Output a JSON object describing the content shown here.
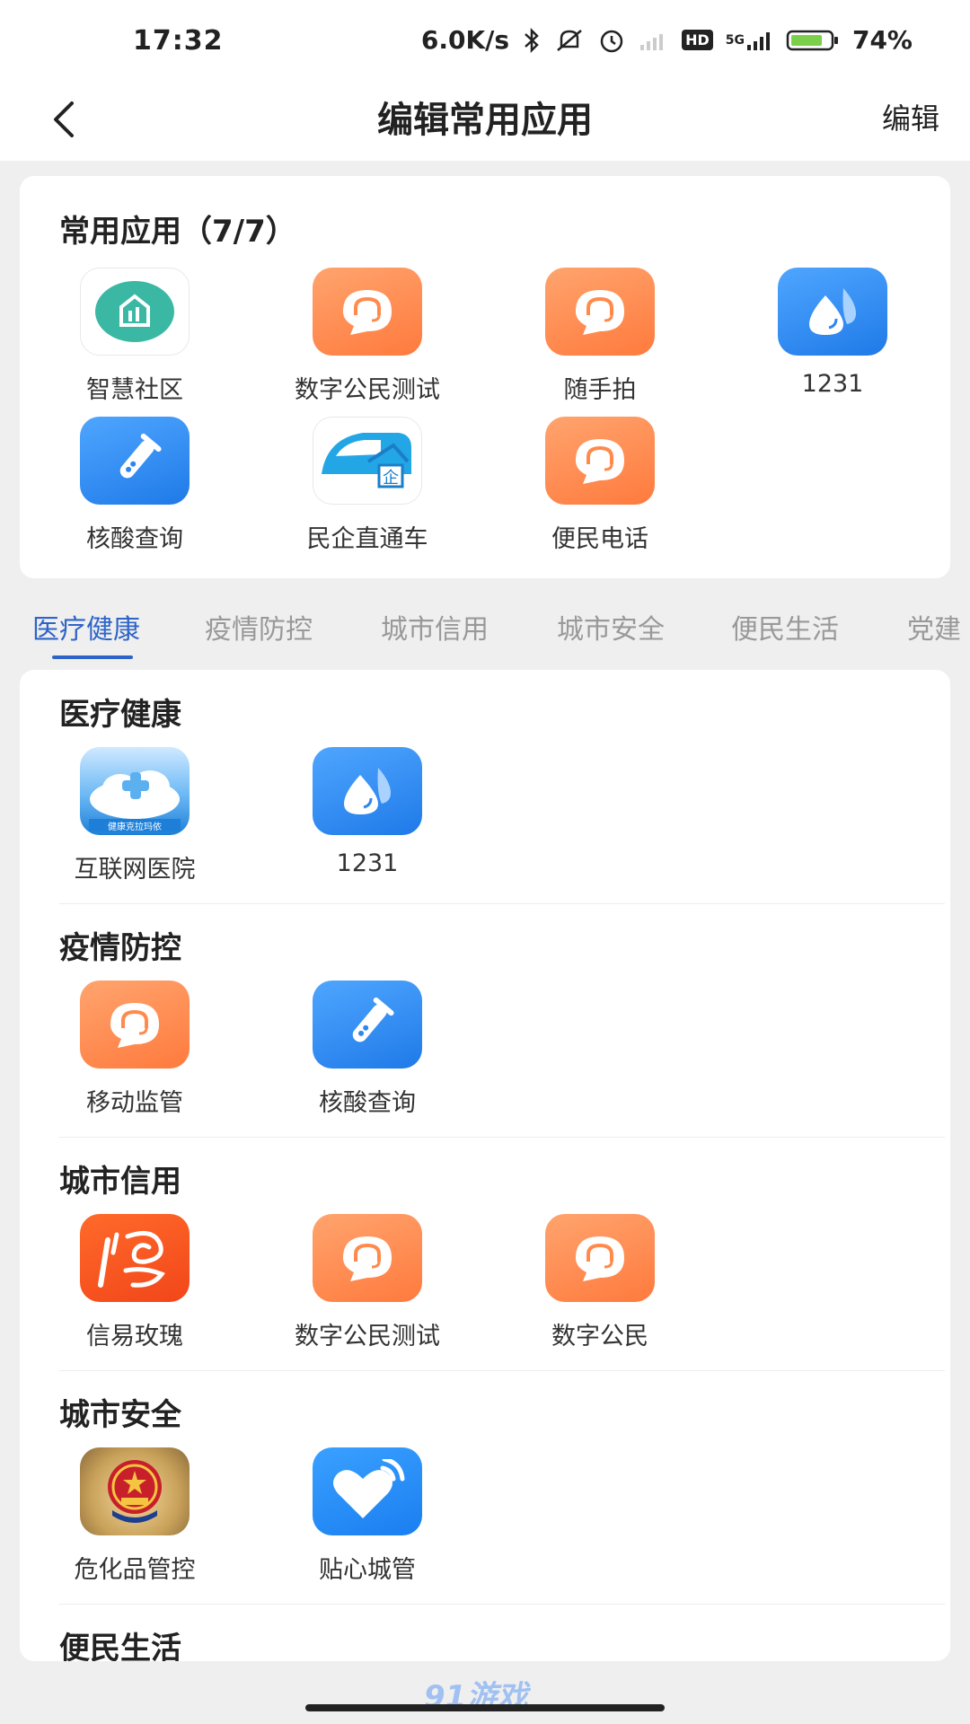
{
  "status_bar": {
    "time": "17:32",
    "net_speed": "6.0K/s",
    "battery": "74%",
    "hd": "HD",
    "sig_5g": "5G",
    "icons": [
      "bluetooth-icon",
      "mute-icon",
      "alarm-icon",
      "wifi-off-icon",
      "hd-icon",
      "signal-icon",
      "battery-icon"
    ]
  },
  "nav": {
    "back_icon": "chevron-left-icon",
    "title": "编辑常用应用",
    "edit_label": "编辑"
  },
  "favorites": {
    "title": "常用应用（7/7）",
    "apps": [
      {
        "label": "智慧社区",
        "icon": "community-icon"
      },
      {
        "label": "数字公民测试",
        "icon": "headset-chat-icon"
      },
      {
        "label": "随手拍",
        "icon": "headset-chat-icon"
      },
      {
        "label": "1231",
        "icon": "droplet-icon"
      },
      {
        "label": "核酸查询",
        "icon": "test-tube-icon"
      },
      {
        "label": "民企直通车",
        "icon": "train-icon"
      },
      {
        "label": "便民电话",
        "icon": "headset-chat-icon"
      }
    ]
  },
  "tabs": [
    {
      "label": "医疗健康",
      "active": true
    },
    {
      "label": "疫情防控",
      "active": false
    },
    {
      "label": "城市信用",
      "active": false
    },
    {
      "label": "城市安全",
      "active": false
    },
    {
      "label": "便民生活",
      "active": false
    },
    {
      "label": "党建",
      "active": false
    }
  ],
  "sections": [
    {
      "title": "医疗健康",
      "apps": [
        {
          "label": "互联网医院",
          "icon": "hospital-icon",
          "badge": "健康克拉玛依"
        },
        {
          "label": "1231",
          "icon": "droplet-icon"
        }
      ]
    },
    {
      "title": "疫情防控",
      "apps": [
        {
          "label": "移动监管",
          "icon": "headset-chat-icon"
        },
        {
          "label": "核酸查询",
          "icon": "test-tube-icon"
        }
      ]
    },
    {
      "title": "城市信用",
      "apps": [
        {
          "label": "信易玫瑰",
          "icon": "rose-credit-icon"
        },
        {
          "label": "数字公民测试",
          "icon": "headset-chat-icon"
        },
        {
          "label": "数字公民",
          "icon": "headset-chat-icon"
        }
      ]
    },
    {
      "title": "城市安全",
      "apps": [
        {
          "label": "危化品管控",
          "icon": "police-emblem-icon"
        },
        {
          "label": "贴心城管",
          "icon": "heart-signal-icon"
        }
      ]
    },
    {
      "title": "便民生活",
      "apps": []
    }
  ],
  "watermark": "91游戏",
  "colors": {
    "accent": "#2e64c8",
    "orange": "#ff8a4c",
    "blue": "#2f86f0"
  }
}
